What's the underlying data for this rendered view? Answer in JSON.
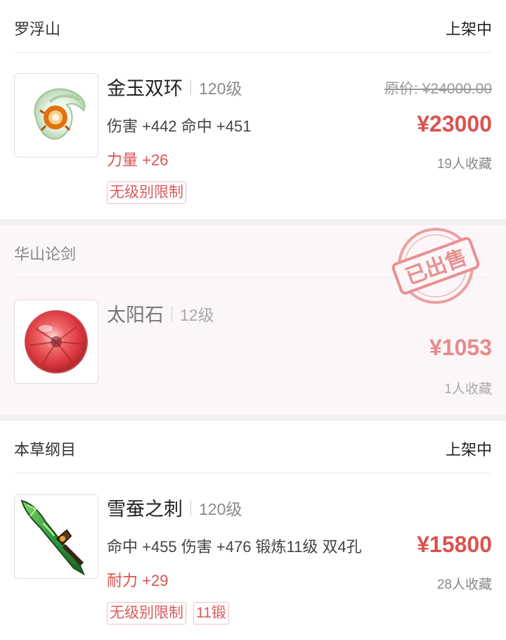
{
  "listings": [
    {
      "server": "罗浮山",
      "status": "上架中",
      "name": "金玉双环",
      "level": "120级",
      "stats": "伤害 +442 命中 +451",
      "bonus": "力量 +26",
      "tags": [
        "无级别限制"
      ],
      "original_price": "原价: ¥24000.00",
      "price": "¥23000",
      "favorites": "19人收藏",
      "icon": "jade-ring-weapon-icon"
    },
    {
      "server": "华山论剑",
      "status": "",
      "name": "太阳石",
      "level": "12级",
      "price": "¥1053",
      "favorites": "1人收藏",
      "stamp": "已出售",
      "icon": "sun-stone-gem-icon"
    },
    {
      "server": "本草纲目",
      "status": "上架中",
      "name": "雪蚕之刺",
      "level": "120级",
      "stats": "命中 +455 伤害 +476 锻炼11级 双4孔",
      "bonus": "耐力 +29",
      "tags": [
        "无级别限制",
        "11锻"
      ],
      "price": "¥15800",
      "favorites": "28人收藏",
      "icon": "green-dagger-weapon-icon"
    }
  ],
  "colors": {
    "price_red": "#d9534f",
    "sold_bg": "#fdf6f8",
    "stamp_red": "#e89090"
  }
}
